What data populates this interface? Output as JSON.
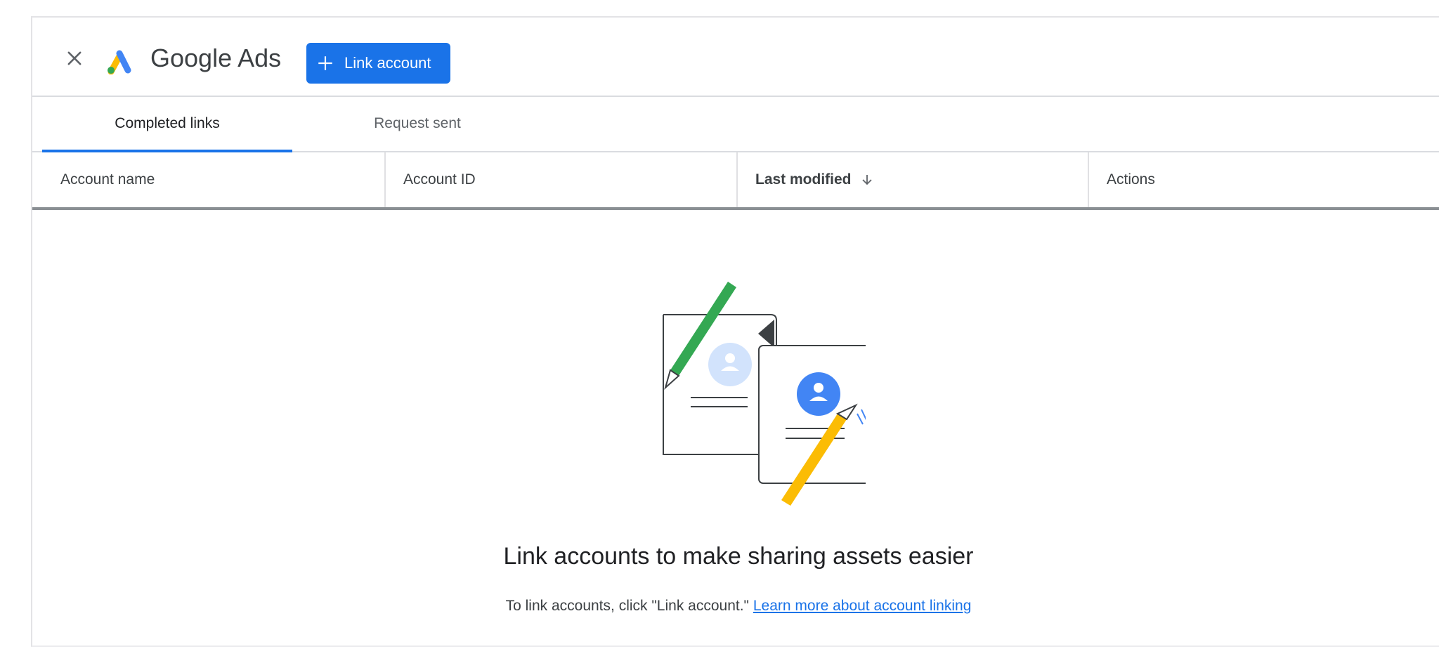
{
  "header": {
    "close_icon": "close-icon",
    "logo_icon": "google-ads-logo-icon",
    "title": "Google Ads",
    "link_account_button": {
      "icon": "plus-icon",
      "label": "Link account"
    }
  },
  "tabs": [
    {
      "label": "Completed links",
      "selected": true
    },
    {
      "label": "Request sent",
      "selected": false
    }
  ],
  "table": {
    "columns": [
      {
        "label": "Account name"
      },
      {
        "label": "Account ID"
      },
      {
        "label": "Last modified",
        "sorted": "descending",
        "sort_icon": "arrow-down-icon"
      },
      {
        "label": "Actions"
      }
    ],
    "rows": []
  },
  "empty_state": {
    "illustration": "linked-documents-illustration",
    "title": "Link accounts to make sharing assets easier",
    "description": "To link accounts, click \"Link account.\"",
    "link_label": "Learn more about account linking"
  },
  "colors": {
    "accent": "#1a73e8",
    "pencil_green": "#34a853",
    "pencil_yellow": "#fbbc04",
    "avatar_blue": "#4285f4",
    "avatar_light": "#d2e3fc"
  }
}
